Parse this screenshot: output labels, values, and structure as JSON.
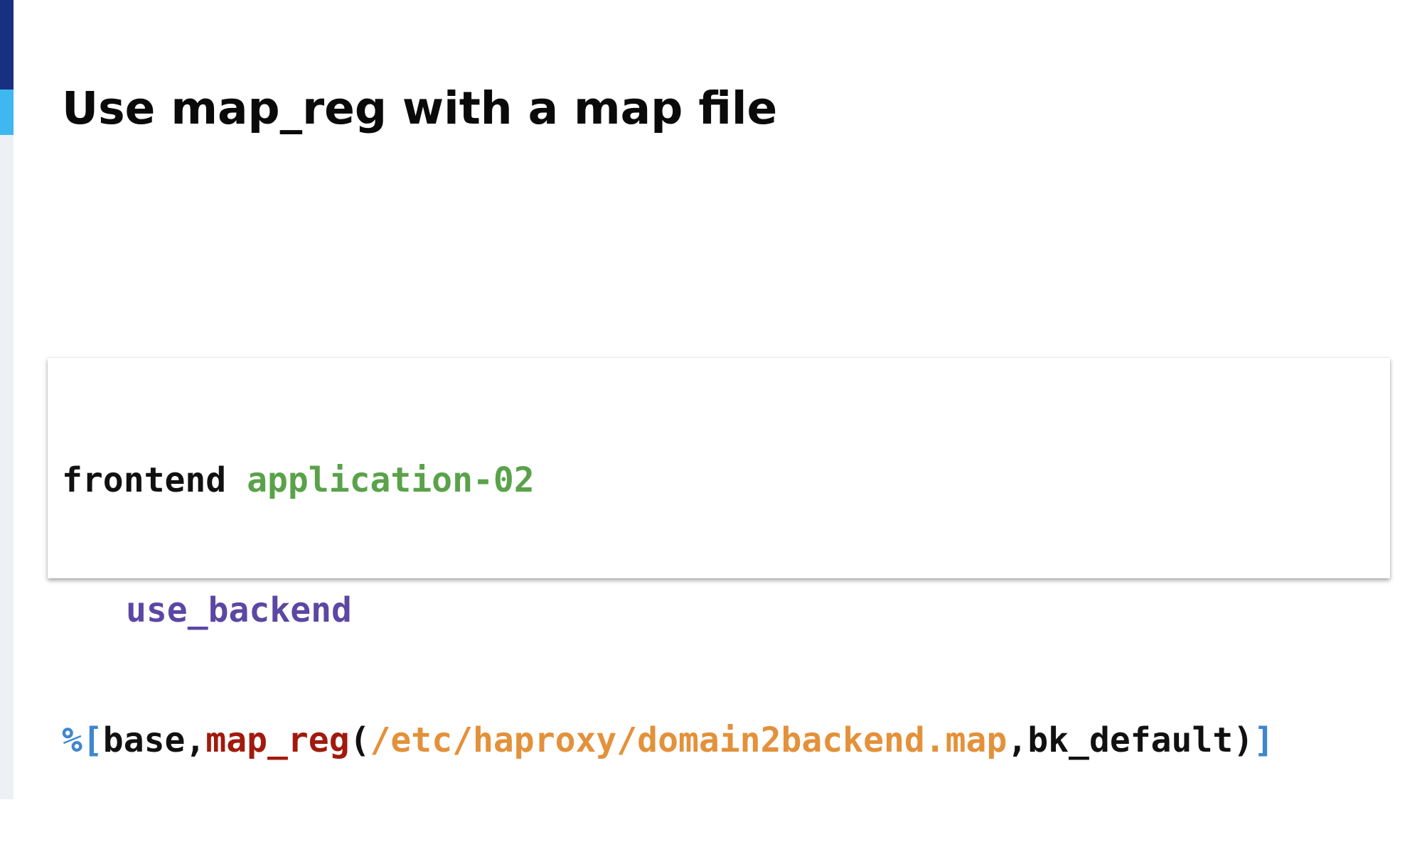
{
  "slide": {
    "title": "Use map_reg with a map file"
  },
  "code": {
    "line1": {
      "keyword": "frontend",
      "space": " ",
      "name": "application-02"
    },
    "line2": {
      "directive": "use_backend"
    },
    "line3": {
      "open": "%[",
      "fetch": "base,",
      "converter": "map_reg",
      "paren_open": "(",
      "path": "/etc/haproxy/domain2backend.map",
      "default_arg": ",bk_default)",
      "close": "]"
    }
  },
  "colors": {
    "rail_dark": "#17307f",
    "rail_light": "#3fb7ef",
    "keyword": "#111111",
    "frontend_name": "#5aa24a",
    "directive": "#5c47a3",
    "bracket": "#3f86cf",
    "converter": "#a11a0d",
    "path": "#e3913a"
  }
}
